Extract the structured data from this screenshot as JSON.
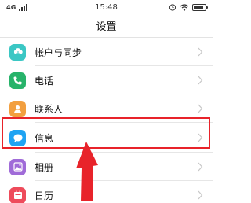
{
  "status_bar": {
    "network": "4G",
    "time": "15:48",
    "battery_level": 0.85,
    "icons": [
      "signal-icon",
      "alarm-icon",
      "wifi-icon",
      "battery-icon"
    ]
  },
  "header": {
    "title": "设置"
  },
  "settings_items": [
    {
      "label": "帐户与同步",
      "icon": "sync-icon",
      "color": "#3bc7c4"
    },
    {
      "label": "电话",
      "icon": "phone-icon",
      "color": "#27b36a"
    },
    {
      "label": "联系人",
      "icon": "contacts-icon",
      "color": "#f29f3f"
    },
    {
      "label": "信息",
      "icon": "message-icon",
      "color": "#1fa3f2"
    },
    {
      "label": "相册",
      "icon": "gallery-icon",
      "color": "#a06bd8"
    },
    {
      "label": "日历",
      "icon": "calendar-icon",
      "color": "#ee4b5b"
    }
  ],
  "annotation": {
    "highlight_color": "#e8232a"
  }
}
